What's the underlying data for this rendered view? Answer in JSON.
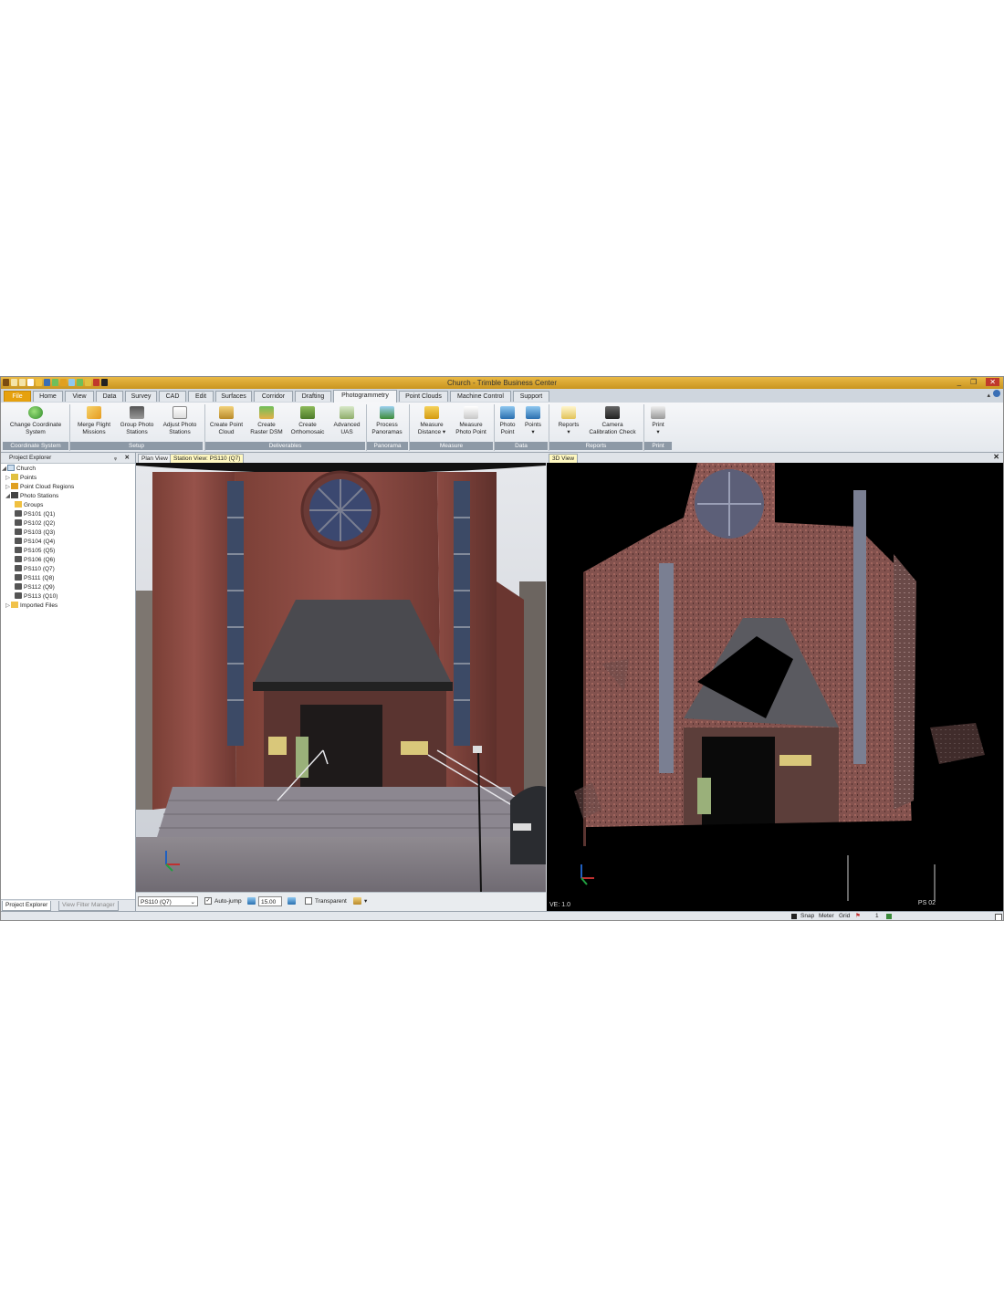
{
  "window": {
    "title": "Church - Trimble Business Center",
    "controls": [
      "_",
      "❐",
      "✕"
    ]
  },
  "tabs": [
    "File",
    "Home",
    "View",
    "Data",
    "Survey",
    "CAD",
    "Edit",
    "Surfaces",
    "Corridor",
    "Drafting",
    "Photogrammetry",
    "Point Clouds",
    "Machine Control",
    "Support"
  ],
  "active_tab": "Photogrammetry",
  "ribbon": {
    "buttons": [
      {
        "l1": "Change Coordinate",
        "l2": "System",
        "icon": "globe-icon"
      },
      {
        "l1": "Merge Flight",
        "l2": "Missions",
        "icon": "plane-icon"
      },
      {
        "l1": "Group Photo",
        "l2": "Stations",
        "icon": "group-stations-icon"
      },
      {
        "l1": "Adjust Photo",
        "l2": "Stations",
        "icon": "adjust-triangle-icon"
      },
      {
        "l1": "Create Point",
        "l2": "Cloud",
        "icon": "point-cloud-icon"
      },
      {
        "l1": "Create",
        "l2": "Raster DSM",
        "icon": "dsm-icon"
      },
      {
        "l1": "Create",
        "l2": "Orthomosaic",
        "icon": "orthomosaic-icon"
      },
      {
        "l1": "Advanced",
        "l2": "UAS",
        "icon": "uas-icon"
      },
      {
        "l1": "Process",
        "l2": "Panoramas",
        "icon": "panorama-icon"
      },
      {
        "l1": "Measure",
        "l2": "Distance ▾",
        "icon": "measure-distance-icon"
      },
      {
        "l1": "Measure",
        "l2": "Photo Point",
        "icon": "measure-photo-point-icon"
      },
      {
        "l1": "Photo",
        "l2": "Point",
        "icon": "photo-point-icon"
      },
      {
        "l1": "Points",
        "l2": "▾",
        "icon": "points-icon"
      },
      {
        "l1": "Reports",
        "l2": "▾",
        "icon": "reports-icon"
      },
      {
        "l1": "Camera",
        "l2": "Calibration Check",
        "icon": "camera-icon"
      },
      {
        "l1": "Print",
        "l2": "▾",
        "icon": "print-icon"
      }
    ],
    "groups": [
      "Coordinate System",
      "Setup",
      "Deliverables",
      "Panorama",
      "Measure",
      "Data",
      "Reports",
      "Print"
    ]
  },
  "explorer": {
    "title": "Project Explorer",
    "pin": "ᵩ",
    "close": "✕",
    "items": [
      "Church",
      "Points",
      "Point Cloud Regions",
      "Photo Stations",
      "Groups",
      "PS101 (Q1)",
      "PS102 (Q2)",
      "PS103 (Q3)",
      "PS104 (Q4)",
      "PS105 (Q5)",
      "PS106 (Q6)",
      "PS110 (Q7)",
      "PS111 (Q8)",
      "PS112 (Q9)",
      "PS113 (Q10)",
      "Imported Files"
    ],
    "bottom_tabs": [
      "Project Explorer",
      "View Filter Manager"
    ]
  },
  "station_view": {
    "tabs": [
      "Plan View",
      "Station View: PS110 (Q7)"
    ],
    "select_value": "PS110 (Q7)",
    "autojump_label": "Auto-jump",
    "autojump_checked": "✓",
    "zoom_value": "15.00",
    "transparent_label": "Transparent",
    "dropdown_arrow": "▾"
  },
  "view3d": {
    "tab": "3D View",
    "ve": "VE: 1.0",
    "station_label": "PS 02",
    "close": "✕"
  },
  "status": {
    "snap": "Snap",
    "units": "Meter",
    "grid": "Grid",
    "count": "1"
  }
}
